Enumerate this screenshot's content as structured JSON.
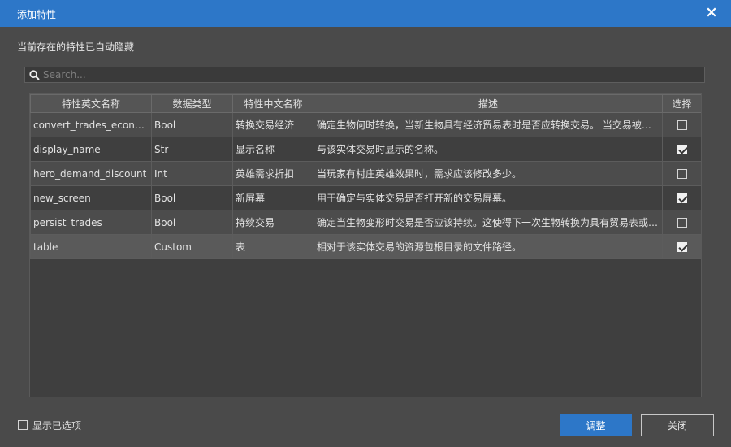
{
  "dialog": {
    "title": "添加特性",
    "hint": "当前存在的特性已自动隐藏"
  },
  "search": {
    "placeholder": "Search...",
    "value": ""
  },
  "table": {
    "headers": [
      "特性英文名称",
      "数据类型",
      "特性中文名称",
      "描述",
      "选择"
    ],
    "rows": [
      {
        "name": "convert_trades_economy",
        "type": "Bool",
        "cn": "转换交易经济",
        "desc": "确定生物何时转换，当新生物具有经济贸易表时是否应转换交易。 当交易被转换时，是否应保留交易。",
        "checked": false
      },
      {
        "name": "display_name",
        "type": "Str",
        "cn": "显示名称",
        "desc": "与该实体交易时显示的名称。",
        "checked": true
      },
      {
        "name": "hero_demand_discount",
        "type": "Int",
        "cn": "英雄需求折扣",
        "desc": "当玩家有村庄英雄效果时，需求应该修改多少。",
        "checked": false
      },
      {
        "name": "new_screen",
        "type": "Bool",
        "cn": "新屏幕",
        "desc": "用于确定与实体交易是否打开新的交易屏幕。",
        "checked": true
      },
      {
        "name": "persist_trades",
        "type": "Bool",
        "cn": "持续交易",
        "desc": "确定当生物变形时交易是否应该持续。这使得下一次生物转换为具有贸易表或经济贸易表的生物时，",
        "checked": false
      },
      {
        "name": "table",
        "type": "Custom",
        "cn": "表",
        "desc": "相对于该实体交易的资源包根目录的文件路径。",
        "checked": true
      }
    ]
  },
  "footer": {
    "show_selected_label": "显示已选项",
    "show_selected_checked": false,
    "confirm_label": "调整",
    "close_label": "关闭"
  },
  "colors": {
    "accent": "#2d77c8",
    "background": "#4a4a4a"
  }
}
